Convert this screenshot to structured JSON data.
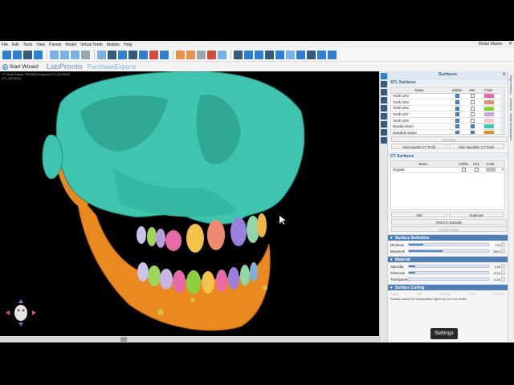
{
  "menubar": {
    "items": [
      "File",
      "Edit",
      "Tools",
      "View",
      "Panels",
      "Model",
      "Virtual Teeth",
      "Module",
      "Help"
    ],
    "app_title": "Model Master"
  },
  "wizard": {
    "start_label": "Start Wizard",
    "brand1": "LabPronto",
    "brand2": "PurchaseExports"
  },
  "viewport": {
    "info_line1": "CT, Model Master, SB0068 Anonymous272_20C19404",
    "info_line2": "272_20C19404"
  },
  "panel": {
    "title": "Surfaces",
    "stl_section": "STL Surfaces",
    "stl_columns": [
      "Name",
      "Visible",
      "Hint",
      "Color"
    ],
    "stl_rows": [
      {
        "name": "Tooth UR4",
        "visible": true,
        "hint": false,
        "color": "#e66aa8"
      },
      {
        "name": "Tooth UR5",
        "visible": true,
        "hint": false,
        "color": "#ef8a6e"
      },
      {
        "name": "Tooth UR6",
        "visible": true,
        "hint": false,
        "color": "#8cd13c"
      },
      {
        "name": "Tooth UR7",
        "visible": true,
        "hint": false,
        "color": "#c8a6e0"
      },
      {
        "name": "Tooth UR8",
        "visible": true,
        "hint": false,
        "color": "#f7c2d0"
      },
      {
        "name": "Maxilla Model",
        "visible": true,
        "hint": true,
        "color": "#3ec9b6"
      },
      {
        "name": "Mandible Model",
        "visible": true,
        "hint": true,
        "color": "#f08a2a"
      }
    ],
    "stl_duplicate": "Duplicate",
    "hide_maxilla": "Hide Maxilla CT Teeth",
    "hide_mandible": "Hide Mandible CT Teeth",
    "ct_section": "CT Surfaces",
    "ct_columns": [
      "Name",
      "Visible",
      "Hint",
      "Color"
    ],
    "ct_rows": [
      {
        "name": "Original",
        "visible": false,
        "hint": false,
        "color": "#bdbdbd"
      }
    ],
    "ct_add": "Add",
    "ct_duplicate": "Duplicate",
    "ct_reset": "Reset to Defaults",
    "ct_create": "Create Model",
    "surface_def_section": "Surface Definition",
    "minimum_label": "Minimum",
    "minimum_value": "123",
    "minimum_fraction": 0.18,
    "maximum_label": "Maximum",
    "maximum_value": "2623",
    "maximum_fraction": 0.42,
    "material_section": "Material",
    "specular_label": "Specular",
    "specular_value": "1.30",
    "specular_fraction": 0.08,
    "shininess_label": "Shininess",
    "shininess_value": "8.00",
    "shininess_fraction": 0.08,
    "transparency_label": "Transparency",
    "transparency_value": "0.00",
    "transparency_fraction": 0.0,
    "culling_section": "Surface Culling",
    "cull_options": [
      "Apply",
      "Cull",
      "Settings",
      "Clear",
      "Invisible"
    ],
    "cull_note": "Surface cannot be manipulated right now. It is not visible."
  },
  "tooltip": {
    "text": "Settings"
  },
  "side_tabs": [
    "Segmentation",
    "Surfaces",
    "Model Manipulation"
  ],
  "colors": {
    "maxilla": "#3ec9b6",
    "mandible": "#f08a2a",
    "accent": "#2d7fd3"
  }
}
